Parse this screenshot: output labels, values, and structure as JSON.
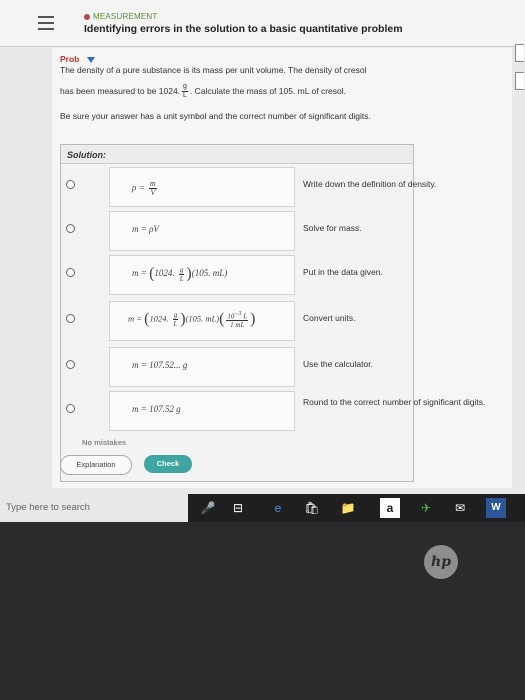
{
  "header": {
    "topic": "MEASUREMENT",
    "title": "Identifying errors in the solution to a basic quantitative problem"
  },
  "problem": {
    "label": "Prob",
    "line1": "The density of a pure substance is its mass per unit volume. The density of cresol",
    "line2a": "has been measured to be 1024.",
    "unit_num": "g",
    "unit_den": "L",
    "line2b": ". Calculate the mass of 105. mL of cresol.",
    "instruction": "Be sure your answer has a unit symbol and the correct number of significant digits."
  },
  "solution": {
    "label": "Solution:",
    "steps": [
      {
        "equation": "ρ = m / V",
        "description": "Write down the definition of density."
      },
      {
        "equation": "m = ρV",
        "description": "Solve for mass."
      },
      {
        "equation": "m = (1024. g/L)(105. mL)",
        "description": "Put in the data given."
      },
      {
        "equation": "m = (1024. g/L)(105. mL)(10⁻³ L / 1 mL)",
        "description": "Convert units."
      },
      {
        "equation": "m = 107.52... g",
        "description": "Use the calculator."
      },
      {
        "equation": "m = 107.52 g",
        "description": "Round to the correct number of significant digits."
      }
    ],
    "no_mistakes": "No mistakes"
  },
  "buttons": {
    "explanation": "Explanation",
    "check": "Check"
  },
  "taskbar": {
    "search_placeholder": "Type here to search"
  },
  "brand": {
    "logo": "hp"
  }
}
